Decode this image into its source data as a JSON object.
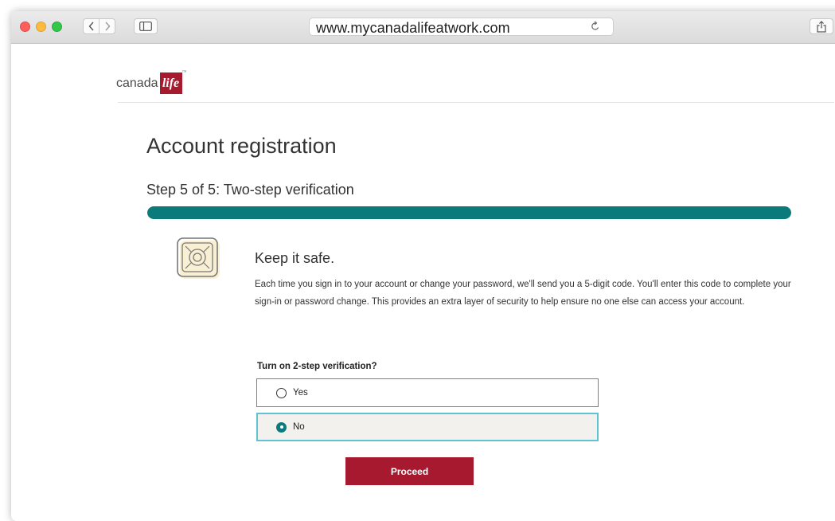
{
  "browser": {
    "url": "www.mycanadalifeatwork.com"
  },
  "logo": {
    "text": "canada",
    "mark": "life",
    "tm": "™"
  },
  "page": {
    "title": "Account registration",
    "step": "Step 5 of 5: Two-step verification",
    "progress": 1.0
  },
  "info": {
    "icon": "safe-icon",
    "heading": "Keep it safe.",
    "description": "Each time you sign in to your account or change your password, we'll send you a 5-digit code. You'll enter this code to complete your sign-in or password change. This provides an extra layer of security to help ensure no one else can access your account."
  },
  "form": {
    "question": "Turn on 2-step verification?",
    "options": [
      {
        "label": "Yes",
        "selected": false
      },
      {
        "label": "No",
        "selected": true
      }
    ],
    "submit_label": "Proceed"
  },
  "colors": {
    "brand": "#a6192e",
    "progress": "#0b7a7a",
    "focus": "#5fc3d4"
  }
}
